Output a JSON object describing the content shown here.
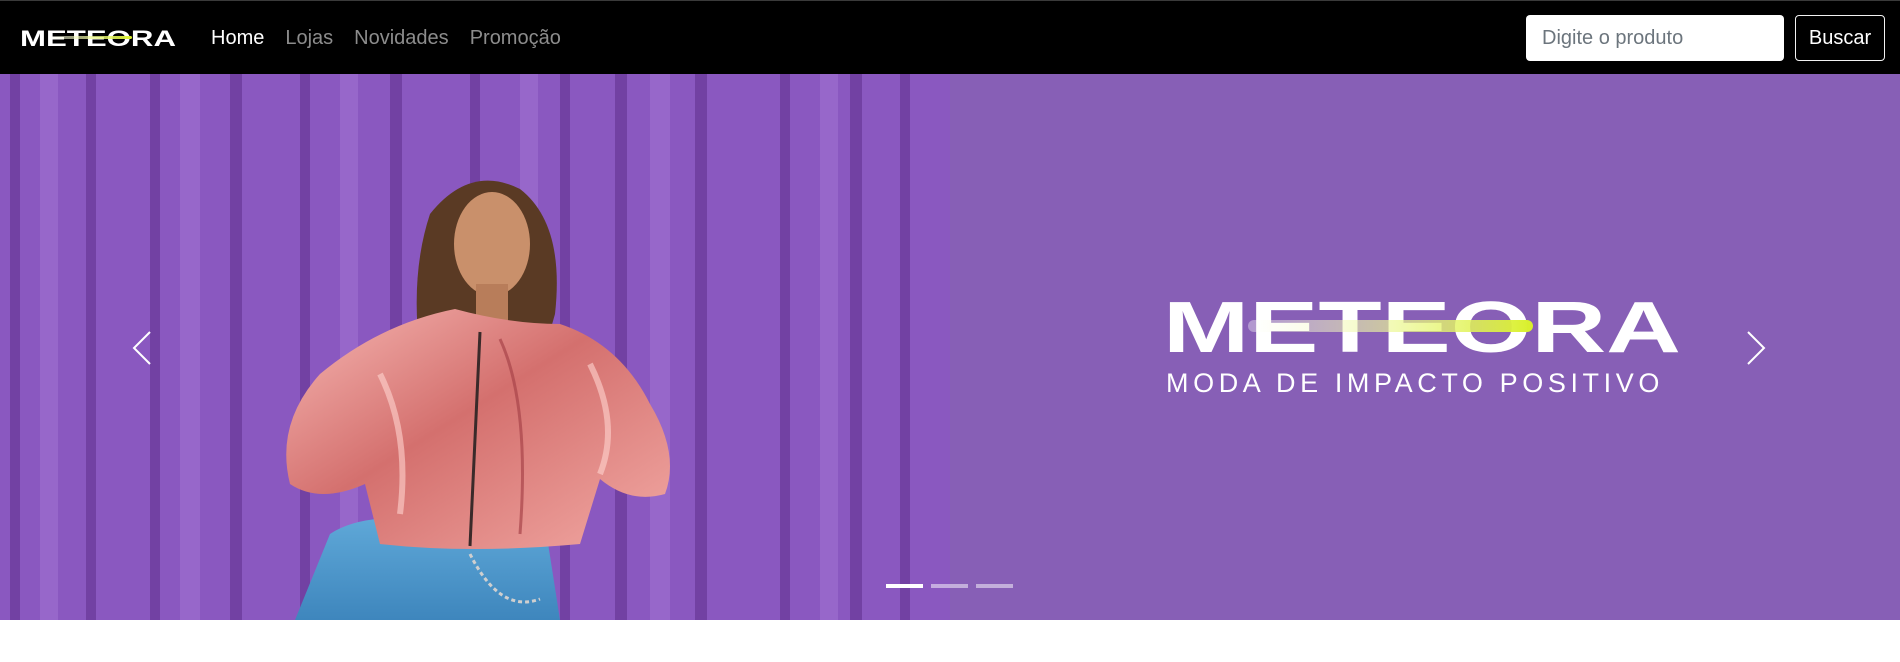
{
  "navbar": {
    "brand": "METEORA",
    "links": [
      {
        "label": "Home",
        "active": true
      },
      {
        "label": "Lojas",
        "active": false
      },
      {
        "label": "Novidades",
        "active": false
      },
      {
        "label": "Promoção",
        "active": false
      }
    ],
    "search": {
      "placeholder": "Digite o produto",
      "value": "",
      "button_label": "Buscar"
    }
  },
  "carousel": {
    "banner": {
      "logo_text": "METEORA",
      "tagline": "MODA DE IMPACTO POSITIVO"
    },
    "controls": {
      "prev_icon": "chevron-left-icon",
      "next_icon": "chevron-right-icon"
    },
    "slide_count": 3,
    "active_slide": 1
  },
  "colors": {
    "navbar_bg": "#000000",
    "banner_purple": "#875fb6",
    "accent_lime": "#d9f02a"
  }
}
